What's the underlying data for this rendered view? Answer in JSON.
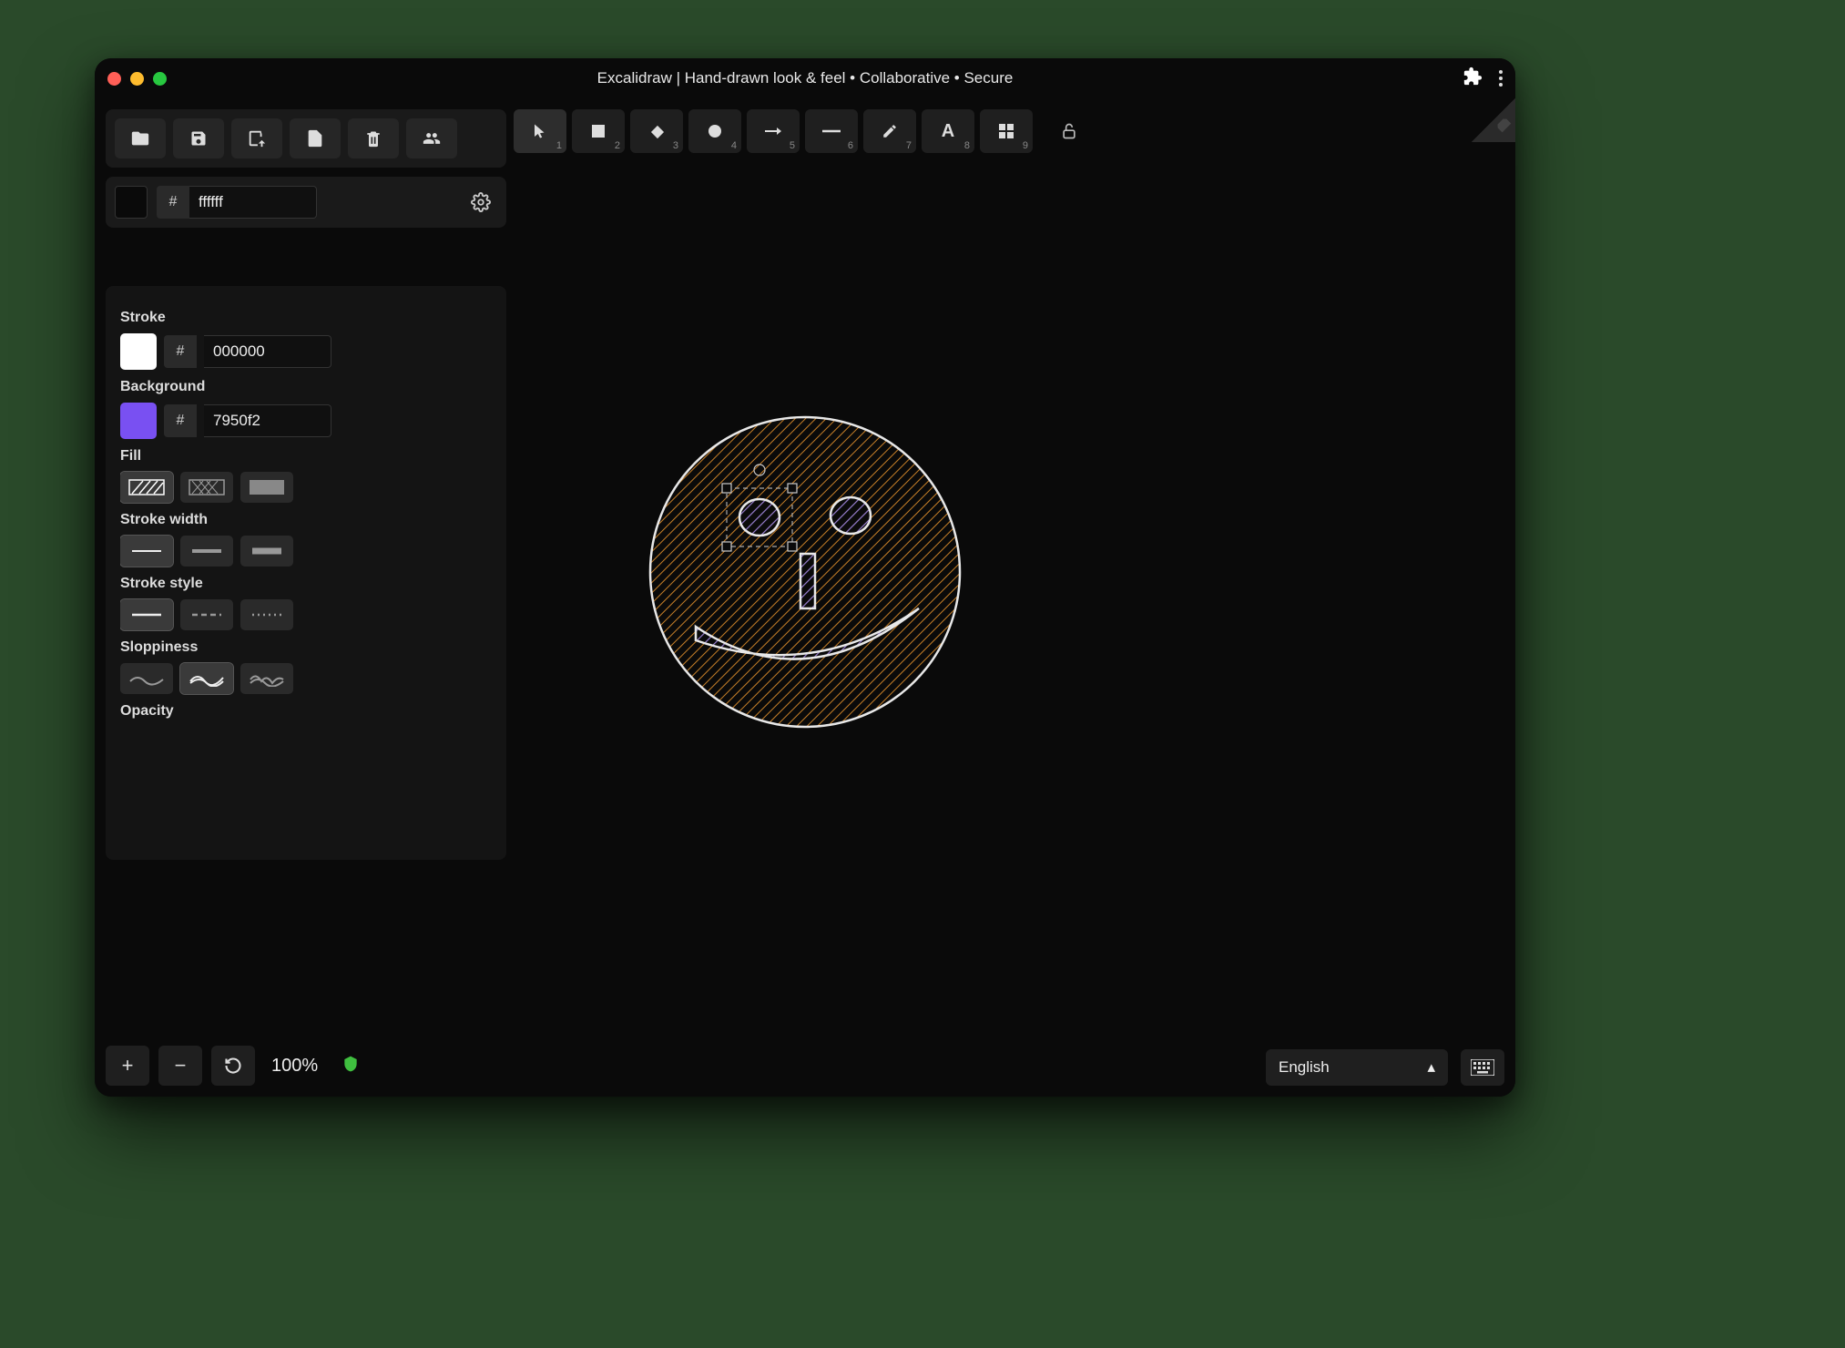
{
  "window": {
    "title": "Excalidraw | Hand-drawn look & feel • Collaborative • Secure"
  },
  "canvas_color": {
    "hash": "#",
    "value": "ffffff",
    "swatch": "#0a0a0a"
  },
  "shape_tools": [
    {
      "name": "selection",
      "num": "1"
    },
    {
      "name": "rectangle",
      "num": "2"
    },
    {
      "name": "diamond",
      "num": "3"
    },
    {
      "name": "ellipse",
      "num": "4"
    },
    {
      "name": "arrow",
      "num": "5"
    },
    {
      "name": "line",
      "num": "6"
    },
    {
      "name": "draw",
      "num": "7"
    },
    {
      "name": "text",
      "num": "8"
    },
    {
      "name": "image",
      "num": "9"
    }
  ],
  "props": {
    "stroke_label": "Stroke",
    "stroke_value": "000000",
    "stroke_swatch": "#ffffff",
    "background_label": "Background",
    "background_value": "7950f2",
    "background_swatch": "#7950f2",
    "fill_label": "Fill",
    "stroke_width_label": "Stroke width",
    "stroke_style_label": "Stroke style",
    "sloppiness_label": "Sloppiness",
    "opacity_label": "Opacity",
    "hash": "#"
  },
  "footer": {
    "zoom": "100%",
    "language": "English"
  }
}
